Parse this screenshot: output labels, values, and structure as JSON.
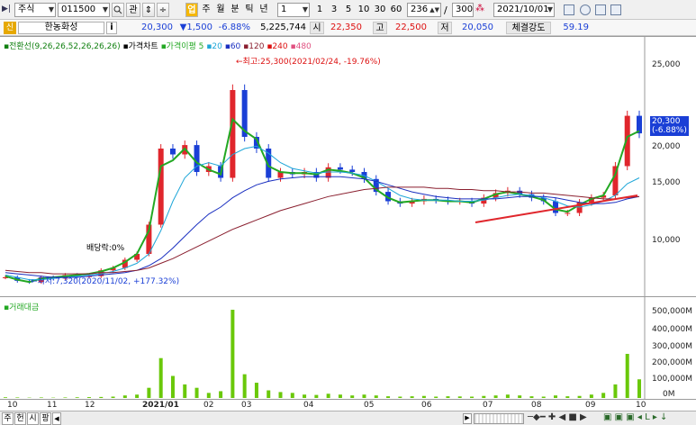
{
  "toolbar": {
    "market_select": "주식",
    "stock_code": "011500",
    "search_btn": "관",
    "highlight_btn": "업",
    "periods": [
      "주",
      "월",
      "분",
      "틱",
      "년"
    ],
    "period_value": "1",
    "intervals": [
      "1",
      "3",
      "5",
      "10",
      "30",
      "60"
    ],
    "count_value": "236",
    "slash": "/",
    "total_value": "300",
    "date_value": "2021/10/01"
  },
  "quote": {
    "badge": "신",
    "stock_name": "한농화성",
    "info_btn": "i",
    "price": "20,300",
    "change": "▼1,500",
    "change_pct": "-6.88%",
    "volume": "5,225,744",
    "open_label": "시",
    "open": "22,350",
    "high_label": "고",
    "high": "22,500",
    "low_label": "저",
    "low": "20,050",
    "strength_label": "체결강도",
    "strength": "59.19"
  },
  "legend": {
    "line1": "전환선(9,26,26,52,26,26,26)",
    "line2": "가격차트",
    "line3": "가격이평 5",
    "ma20": "20",
    "ma60": "60",
    "ma120": "120",
    "ma240": "240",
    "ma480": "480"
  },
  "annotations": {
    "max_label": "←최고:25,300(2021/02/24, -19.76%)",
    "min_label": "←최저:7,320(2020/11/02, +177.32%)",
    "dividend_label": "배당락:0%",
    "price_tag_1": "20,300",
    "price_tag_2": "(-6.88%)"
  },
  "volume_panel": {
    "title": "거래대금"
  },
  "bottom_tabs": [
    "주",
    "헌",
    "시",
    "팡"
  ],
  "chart_data": [
    {
      "type": "line",
      "title": "",
      "xlabel": "",
      "ylabel": "",
      "ylim": [
        7000,
        27000
      ],
      "yticks": [
        "25,000",
        "20,000",
        "15,000",
        "10,000"
      ],
      "xticks": [
        "10",
        "11",
        "12",
        "2021/01",
        "02",
        "03",
        "04",
        "05",
        "06",
        "07",
        "08",
        "09",
        "10"
      ],
      "series": [
        {
          "name": "가격차트",
          "values": [
            8000,
            7700,
            7600,
            8000,
            7900,
            8200,
            8100,
            8100,
            8600,
            8800,
            9500,
            10000,
            12500,
            19000,
            18500,
            19300,
            17000,
            17500,
            16500,
            24000,
            20000,
            19000,
            16500,
            17000,
            16800,
            17000,
            16500,
            17400,
            17200,
            17000,
            16400,
            15300,
            14500,
            14300,
            14500,
            14700,
            14600,
            14500,
            14500,
            14300,
            14800,
            15200,
            15400,
            15100,
            14800,
            14500,
            13500,
            13500,
            14400,
            14800,
            15000,
            17500,
            21800,
            20300
          ]
        },
        {
          "name": "5",
          "values": [
            8100,
            7800,
            7600,
            7900,
            8000,
            8100,
            8200,
            8300,
            8500,
            8800,
            9300,
            10000,
            12000,
            17500,
            18000,
            19000,
            17800,
            17200,
            16800,
            21500,
            20500,
            19800,
            17500,
            17000,
            16900,
            16900,
            16800,
            17200,
            17100,
            16900,
            16500,
            15500,
            14800,
            14400,
            14500,
            14600,
            14600,
            14500,
            14500,
            14400,
            14700,
            15100,
            15300,
            15100,
            14900,
            14600,
            13800,
            13600,
            14200,
            14700,
            15000,
            16800,
            20000,
            20500
          ]
        },
        {
          "name": "20",
          "values": [
            8200,
            8000,
            7800,
            7800,
            7900,
            8000,
            8100,
            8200,
            8300,
            8500,
            8800,
            9200,
            10000,
            12000,
            14500,
            16500,
            17500,
            17800,
            17500,
            18500,
            19000,
            19200,
            18600,
            17800,
            17300,
            17100,
            16900,
            17000,
            17000,
            16900,
            16700,
            16200,
            15600,
            15000,
            14700,
            14600,
            14600,
            14600,
            14500,
            14500,
            14600,
            14800,
            15000,
            15100,
            15000,
            14800,
            14500,
            14100,
            14000,
            14200,
            14500,
            15000,
            16000,
            16500
          ]
        },
        {
          "name": "60",
          "values": [
            8400,
            8300,
            8200,
            8100,
            8000,
            8000,
            8000,
            8100,
            8200,
            8300,
            8400,
            8600,
            9000,
            9600,
            10500,
            11500,
            12500,
            13400,
            14000,
            14800,
            15400,
            15900,
            16200,
            16400,
            16500,
            16600,
            16600,
            16600,
            16600,
            16500,
            16400,
            16200,
            15900,
            15600,
            15300,
            15100,
            14900,
            14800,
            14700,
            14700,
            14700,
            14700,
            14800,
            14900,
            14900,
            14900,
            14800,
            14600,
            14400,
            14300,
            14300,
            14400,
            14700,
            14900
          ]
        },
        {
          "name": "120",
          "values": [
            8600,
            8500,
            8400,
            8400,
            8300,
            8300,
            8300,
            8300,
            8400,
            8400,
            8500,
            8600,
            8800,
            9200,
            9600,
            10100,
            10600,
            11100,
            11600,
            12100,
            12500,
            12900,
            13300,
            13700,
            14000,
            14300,
            14600,
            14900,
            15100,
            15300,
            15500,
            15600,
            15700,
            15700,
            15700,
            15700,
            15600,
            15600,
            15500,
            15500,
            15400,
            15400,
            15300,
            15300,
            15200,
            15200,
            15100,
            15000,
            14900,
            14800,
            14700,
            14700,
            14800,
            14900
          ]
        }
      ]
    },
    {
      "type": "bar",
      "title": "거래대금",
      "ylabel": "",
      "ylim": [
        0,
        520
      ],
      "yticks": [
        "500,000M",
        "400,000M",
        "300,000M",
        "200,000M",
        "100,000M",
        "0M"
      ],
      "xticks": [
        "10",
        "11",
        "12",
        "2021/01",
        "02",
        "03",
        "04",
        "05",
        "06",
        "07",
        "08",
        "09",
        "10"
      ],
      "series": [
        {
          "name": "거래대금",
          "values": [
            4,
            3,
            2,
            3,
            2,
            3,
            4,
            5,
            6,
            8,
            15,
            20,
            60,
            235,
            130,
            80,
            60,
            30,
            40,
            520,
            140,
            90,
            45,
            35,
            30,
            20,
            18,
            25,
            20,
            15,
            20,
            15,
            10,
            8,
            10,
            12,
            8,
            10,
            9,
            8,
            12,
            15,
            20,
            15,
            10,
            8,
            15,
            10,
            12,
            20,
            30,
            80,
            260,
            110
          ]
        }
      ]
    }
  ]
}
